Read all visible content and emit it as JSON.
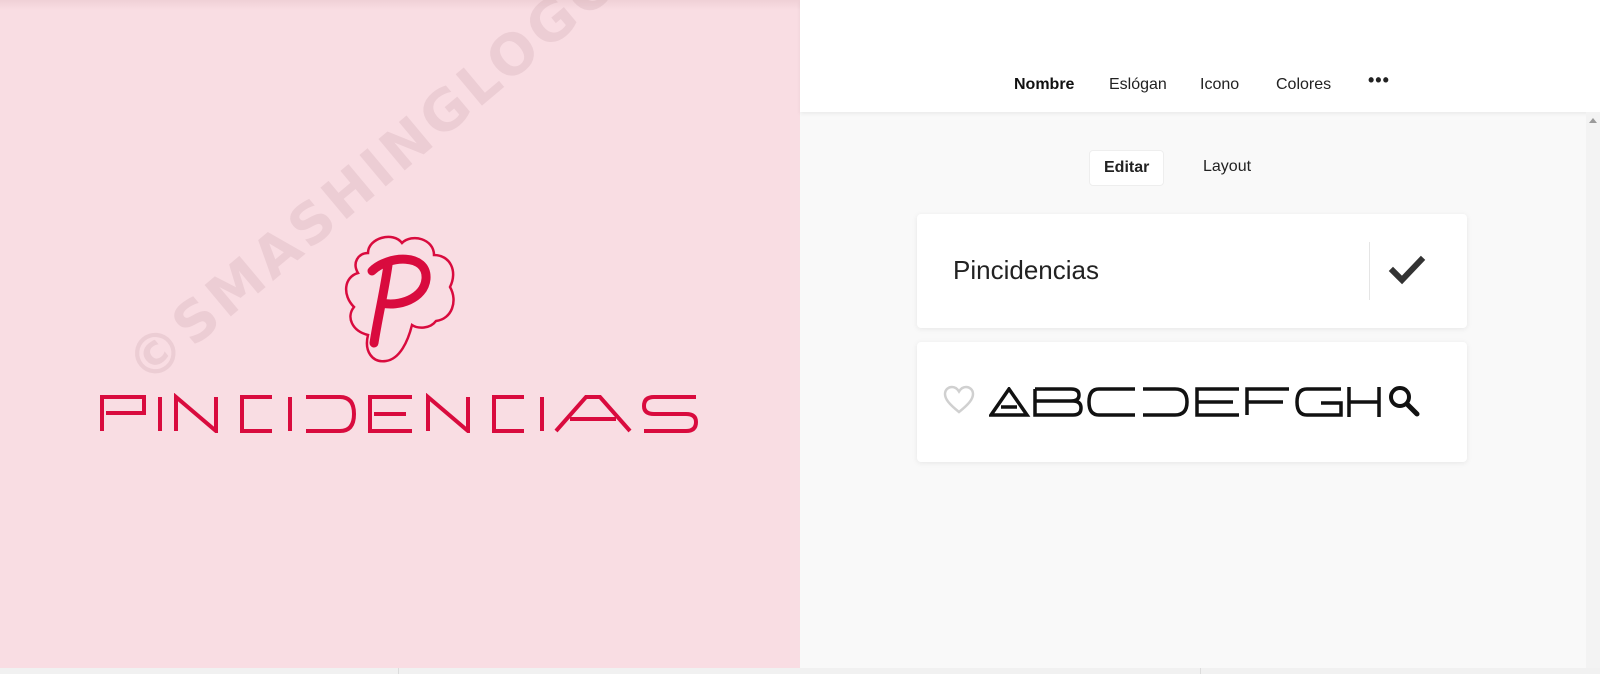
{
  "preview": {
    "brand_name": "PINCIDENCIAS",
    "monogram": "P",
    "watermark": "©SMASHINGLOGO",
    "background_color": "#f9dde3",
    "brand_color": "#d90b3e"
  },
  "nav": {
    "items": [
      {
        "label": "Nombre",
        "active": true
      },
      {
        "label": "Eslógan",
        "active": false
      },
      {
        "label": "Icono",
        "active": false
      },
      {
        "label": "Colores",
        "active": false
      }
    ],
    "more_label": "•••"
  },
  "subtabs": [
    {
      "label": "Editar",
      "active": true
    },
    {
      "label": "Layout",
      "active": false
    }
  ],
  "name_card": {
    "value": "Pincidencias",
    "confirm_icon": "checkmark-icon"
  },
  "font_card": {
    "sample_text": "ABCDEFGH",
    "favorite_icon": "heart-outline-icon",
    "search_icon": "search-icon"
  }
}
